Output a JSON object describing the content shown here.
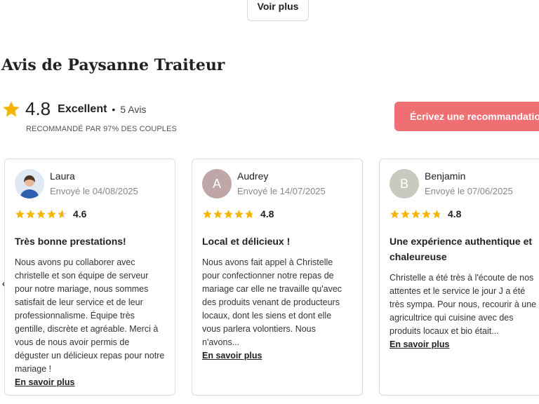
{
  "top": {
    "voir_plus": "Voir plus"
  },
  "header": {
    "title": "Avis de Paysanne Traiteur"
  },
  "rating": {
    "score": "4.8",
    "quality": "Excellent",
    "separator": "•",
    "count": "5 Avis",
    "recommend": "RECOMMANDÉ PAR 97% DES COUPLES",
    "star_color": "#f5b400"
  },
  "actions": {
    "write_label": "Écrivez une recommandation",
    "accent": "#ef6f72"
  },
  "carousel": {
    "prev_icon": "chevron-left-icon"
  },
  "reviews": [
    {
      "name": "Laura",
      "initial": "",
      "date": "Envoyé le 04/08/2025",
      "stars": 4.6,
      "score": "4.6",
      "title": "Très bonne prestations!",
      "text": "Nous avons pu collaborer avec christelle et son équipe de serveur pour notre mariage, nous sommes satisfait de leur service et de leur professionnalisme. Équipe très gentille, discrète et agréable. Merci à vous de nous avoir permis de déguster un délicieux repas pour notre mariage !",
      "link": "En savoir plus"
    },
    {
      "name": "Audrey",
      "initial": "A",
      "avatar_color": "#bfa6a7",
      "date": "Envoyé le 14/07/2025",
      "stars": 4.8,
      "score": "4.8",
      "title": "Local et délicieux !",
      "text": "Nous avons fait appel à Christelle pour confectionner notre repas de mariage car elle ne travaille qu'avec des produits venant de producteurs locaux, dont les siens et dont elle vous parlera volontiers. Nous n'avons...",
      "link": "En savoir plus"
    },
    {
      "name": "Benjamin",
      "initial": "B",
      "avatar_color": "#c9c9bf",
      "date": "Envoyé le 07/06/2025",
      "stars": 4.8,
      "score": "4.8",
      "title": "Une expérience authentique et chaleureuse",
      "text": "Christelle a été très à l'écoute de nos attentes et le service le jour J a été très sympa. Pour nous, recourir à une agricultrice qui cuisine avec des produits locaux et bio était...",
      "link": "En savoir plus"
    }
  ]
}
